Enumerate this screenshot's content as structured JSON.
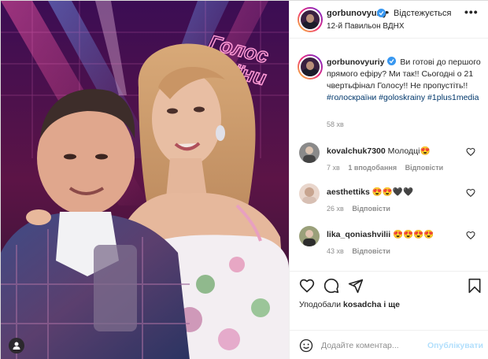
{
  "photo": {
    "sign_text_top": "Голос",
    "sign_text_bottom": "Країни"
  },
  "header": {
    "username": "gorbunovyuriy",
    "dot": "•",
    "follow_label": "Відстежується",
    "location": "12-й Павильон ВДНХ",
    "more": "•••"
  },
  "caption": {
    "username": "gorbunovyuriy",
    "text": "Ви готові до першого прямого ефіру? Ми так!! Сьогодні о 21 чвертьфінал Голосу!! Не пропустіть!!",
    "hashtags": [
      "#голоскраїни",
      "#goloskrainy",
      "#1plus1media"
    ],
    "time": "58 хв"
  },
  "comments": [
    {
      "username": "kovalchuk7300",
      "text": "Молодці😍",
      "time": "7 хв",
      "likes": "1 вподобання",
      "reply": "Відповісти"
    },
    {
      "username": "aesthettiks",
      "text": "😍😍🖤🖤",
      "time": "26 хв",
      "likes": "",
      "reply": "Відповісти"
    },
    {
      "username": "lika_qoniashvilii",
      "text": "😍😍😍😍",
      "time": "43 хв",
      "likes": "",
      "reply": "Відповісти"
    }
  ],
  "likes": {
    "prefix": "Уподобали",
    "username": "kosadcha",
    "suffix": "і ще"
  },
  "add_comment": {
    "placeholder": "Додайте коментар...",
    "publish_label": "Опублікувати"
  },
  "colors": {
    "verified": "#3897f0",
    "link": "#00376b",
    "publish_disabled": "#b2dffc",
    "meta": "#8e8e8e"
  }
}
